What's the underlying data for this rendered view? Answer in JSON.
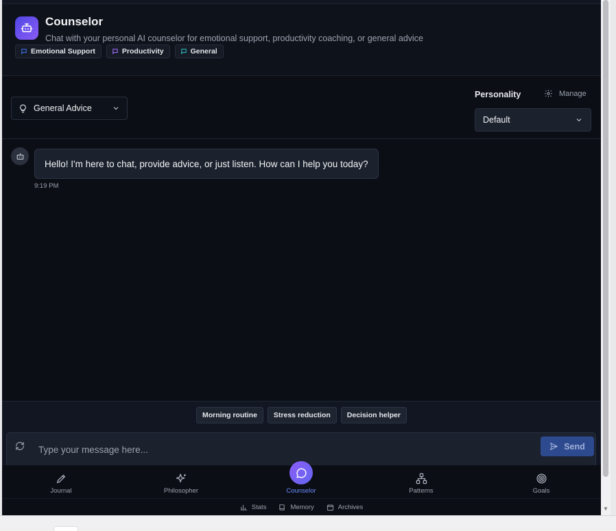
{
  "header": {
    "title": "Counselor",
    "subtitle": "Chat with your personal AI counselor for emotional support, productivity coaching, or general advice",
    "tags": [
      {
        "label": "Emotional Support",
        "color": "#3b6fe0"
      },
      {
        "label": "Productivity",
        "color": "#9b6bf2"
      },
      {
        "label": "General",
        "color": "#2fb4b4"
      }
    ]
  },
  "controls": {
    "mode": "General Advice",
    "personality_label": "Personality",
    "manage_label": "Manage",
    "personality_value": "Default"
  },
  "messages": [
    {
      "sender": "bot",
      "text": "Hello! I'm here to chat, provide advice, or just listen. How can I help you today?",
      "time": "9:19 PM"
    }
  ],
  "quick_prompts": [
    "Morning routine",
    "Stress reduction",
    "Decision helper"
  ],
  "composer": {
    "placeholder": "Type your message here...",
    "send_label": "Send"
  },
  "nav": {
    "items": [
      {
        "label": "Journal",
        "icon": "pen-nib-icon"
      },
      {
        "label": "Philosopher",
        "icon": "sparkles-icon"
      },
      {
        "label": "Counselor",
        "icon": "chat-bubble-icon",
        "active": true
      },
      {
        "label": "Patterns",
        "icon": "network-icon"
      },
      {
        "label": "Goals",
        "icon": "target-icon"
      }
    ],
    "secondary": [
      {
        "label": "Stats",
        "icon": "bar-chart-icon"
      },
      {
        "label": "Memory",
        "icon": "book-icon"
      },
      {
        "label": "Archives",
        "icon": "calendar-icon"
      }
    ]
  },
  "colors": {
    "accent": "#6b8cff",
    "background": "#0b0e15",
    "panel": "#1b212d",
    "send_button": "#2e4a8f"
  }
}
